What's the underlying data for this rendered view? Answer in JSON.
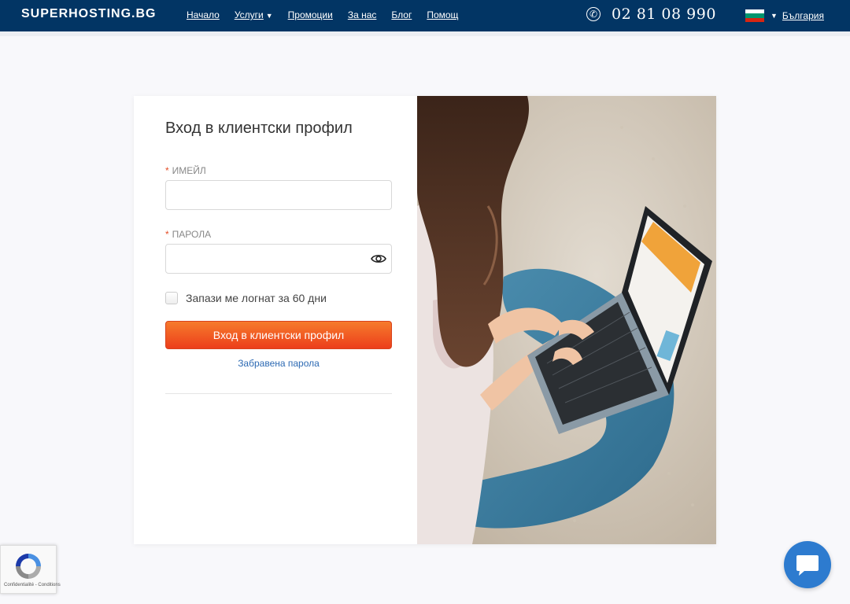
{
  "header": {
    "logo": "SUPERHOSTING.BG",
    "nav": [
      {
        "label": "Начало"
      },
      {
        "label": "Услуги",
        "caret": "▼"
      },
      {
        "label": "Промоции"
      },
      {
        "label": "За нас"
      },
      {
        "label": "Блог"
      },
      {
        "label": "Помощ"
      }
    ],
    "phone_glyph": "✆",
    "phone": "02 81 08 990",
    "language": {
      "label": "България",
      "caret": "▼",
      "flag_colors": [
        "#ffffff",
        "#00966e",
        "#d62612"
      ]
    }
  },
  "login": {
    "title": "Вход в клиентски профил",
    "required_mark": "*",
    "email_label": "ИМЕЙЛ",
    "email_value": "",
    "password_label": "ПАРОЛА",
    "password_value": "",
    "remember_label": "Запази ме логнат за 60 дни",
    "submit_label": "Вход в клиентски профил",
    "forgot_label": "Забравена парола"
  },
  "recaptcha": {
    "text": "Confidentialité - Conditions"
  },
  "colors": {
    "header_bg": "#023564",
    "accent": "#f0501f",
    "link": "#2d6ab3",
    "chat": "#2d7bcf"
  },
  "icons": {
    "phone": "phone-icon",
    "eye": "eye-icon",
    "chat": "chat-bubble-icon",
    "recaptcha": "recaptcha-logo-icon"
  }
}
